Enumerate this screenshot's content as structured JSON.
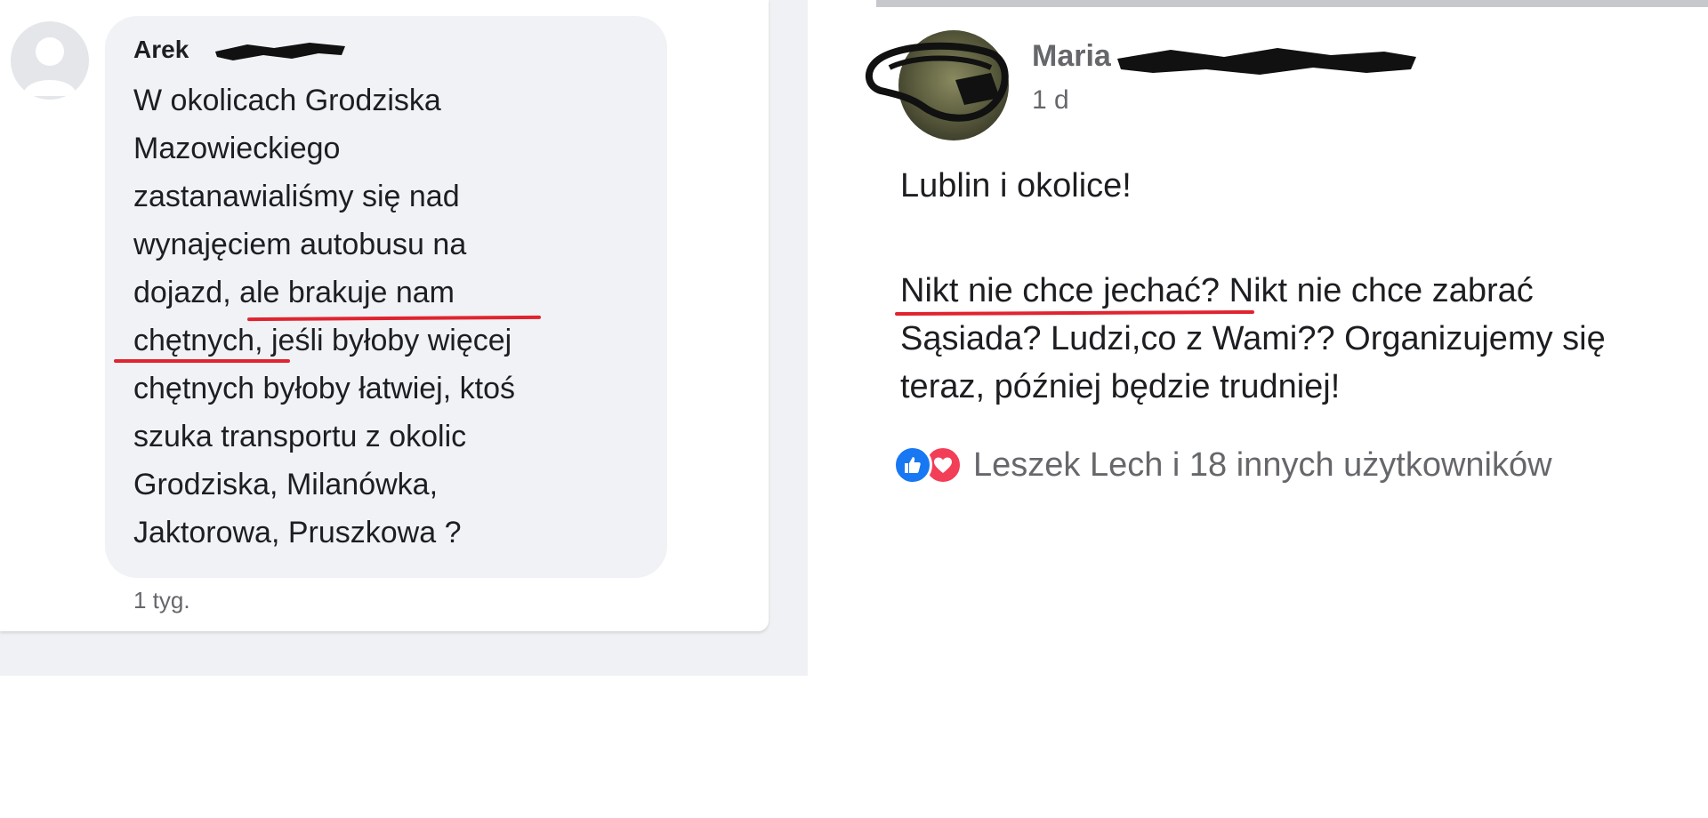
{
  "left_comment": {
    "author_visible": "Arek",
    "text": "W okolicach Grodziska\nMazowieckiego\nzastanawialiśmy się nad\nwynajęciem autobusu na\ndojazd, ale brakuje nam\nchętnych, jeśli byłoby więcej\nchętnych byłoby łatwiej, ktoś\nszuka transportu z okolic\nGrodziska, Milanówka,\nJaktorowa, Pruszkowa ?",
    "timestamp": "1 tyg.",
    "avatar_icon": "default-user-avatar-icon"
  },
  "right_post": {
    "author_visible": "Maria",
    "timestamp": "1 d",
    "title": "Lublin i okolice!",
    "body": "Nikt nie chce jechać? Nikt nie chce zabrać\nSąsiada? Ludzi,co z Wami?? Organizujemy się\nteraz, później będzie trudniej!",
    "reactions_text": "Leszek Lech i 18 innych użytkowników",
    "reaction_icons": [
      "like-icon",
      "love-icon"
    ]
  },
  "colors": {
    "underline": "#e0242f",
    "like": "#1877f2",
    "love": "#f33e58",
    "muted_text": "#65676b",
    "bubble": "#f0f2f5"
  }
}
